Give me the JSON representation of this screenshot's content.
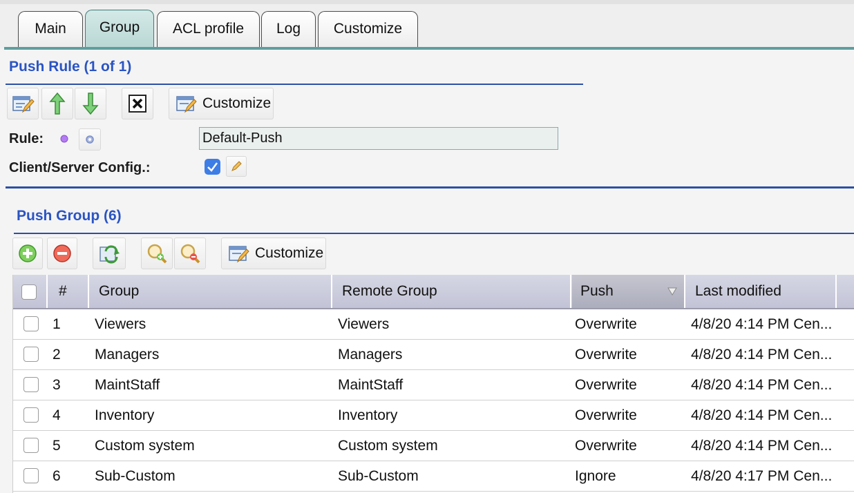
{
  "tabs": [
    {
      "label": "Main"
    },
    {
      "label": "Group"
    },
    {
      "label": "ACL profile"
    },
    {
      "label": "Log"
    },
    {
      "label": "Customize"
    }
  ],
  "active_tab": "Group",
  "push_rule": {
    "title": "Push Rule (1 of 1)",
    "toolbar": {
      "customize_label": "Customize",
      "icons": [
        "edit-icon",
        "move-up-icon",
        "move-down-icon",
        "delete-icon",
        "customize-icon"
      ]
    },
    "rule_label": "Rule:",
    "rule_value": "Default-Push",
    "client_server_label": "Client/Server Config.:",
    "client_server_checked": true
  },
  "push_group": {
    "title": "Push Group (6)",
    "toolbar": {
      "customize_label": "Customize",
      "icons": [
        "add-icon",
        "remove-icon",
        "refresh-icon",
        "zoom-in-icon",
        "zoom-out-icon",
        "customize-icon"
      ]
    },
    "columns": {
      "num": "#",
      "group": "Group",
      "remote_group": "Remote Group",
      "push": "Push",
      "last_modified": "Last modified"
    },
    "rows": [
      {
        "num": "1",
        "group": "Viewers",
        "remote_group": "Viewers",
        "push": "Overwrite",
        "last_modified": "4/8/20 4:14 PM Cen..."
      },
      {
        "num": "2",
        "group": "Managers",
        "remote_group": "Managers",
        "push": "Overwrite",
        "last_modified": "4/8/20 4:14 PM Cen..."
      },
      {
        "num": "3",
        "group": "MaintStaff",
        "remote_group": "MaintStaff",
        "push": "Overwrite",
        "last_modified": "4/8/20 4:14 PM Cen..."
      },
      {
        "num": "4",
        "group": "Inventory",
        "remote_group": "Inventory",
        "push": "Overwrite",
        "last_modified": "4/8/20 4:14 PM Cen..."
      },
      {
        "num": "5",
        "group": "Custom system",
        "remote_group": "Custom system",
        "push": "Overwrite",
        "last_modified": "4/8/20 4:14 PM Cen..."
      },
      {
        "num": "6",
        "group": "Sub-Custom",
        "remote_group": "Sub-Custom",
        "push": "Ignore",
        "last_modified": "4/8/20 4:17 PM Cen..."
      }
    ]
  },
  "colors": {
    "accent_blue": "#2a54c4",
    "tab_active": "#b8d6d3",
    "tab_line": "#5f9e9e",
    "header_bg": "#c2c3d6"
  }
}
